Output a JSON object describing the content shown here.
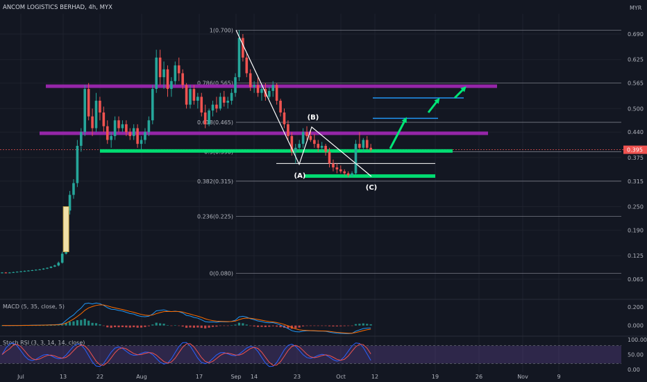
{
  "header": {
    "title": "ANCOM LOGISTICS BERHAD, 4h, MYX",
    "currency": "MYR"
  },
  "chart_data": [
    {
      "type": "candlestick",
      "ylim": [
        0.035,
        0.72
      ],
      "y_ticks": [
        "0.690",
        "0.625",
        "0.565",
        "0.500",
        "0.440",
        "0.375",
        "0.315",
        "0.250",
        "0.190",
        "0.125",
        "0.065"
      ],
      "y_tick_values": [
        0.69,
        0.625,
        0.565,
        0.5,
        0.44,
        0.375,
        0.315,
        0.25,
        0.19,
        0.125,
        0.065
      ],
      "x_ticks": [
        "Jul",
        "13",
        "22",
        "Aug",
        "17",
        "Sep",
        "14",
        "23",
        "Oct",
        "12",
        "19",
        "26",
        "Nov",
        "9"
      ],
      "last_price": "0.395",
      "last_price_value": 0.395,
      "fibonacci": [
        {
          "label": "1(0.700)",
          "value": 0.7
        },
        {
          "label": "0.786(0.565)",
          "value": 0.565
        },
        {
          "label": "0.618(0.465)",
          "value": 0.465
        },
        {
          "label": "0.5(0.390)",
          "value": 0.39
        },
        {
          "label": "0.382(0.315)",
          "value": 0.315
        },
        {
          "label": "0.236(0.225)",
          "value": 0.225
        },
        {
          "label": "0(0.080)",
          "value": 0.08
        }
      ],
      "wave_labels": [
        {
          "label": "(A)",
          "value": 0.358
        },
        {
          "label": "(B)",
          "value": 0.453
        },
        {
          "label": "(C)",
          "value": 0.327
        }
      ],
      "support_resistance": [
        {
          "color": "#9c27b0",
          "value": 0.557
        },
        {
          "color": "#9c27b0",
          "value": 0.437
        },
        {
          "color": "#00e676",
          "value": 0.392
        },
        {
          "color": "#00e676",
          "value": 0.328
        }
      ],
      "targets": [
        0.475,
        0.527
      ],
      "candles": [
        [
          0.082,
          0.083,
          0.08,
          0.082
        ],
        [
          0.082,
          0.083,
          0.08,
          0.081
        ],
        [
          0.081,
          0.083,
          0.08,
          0.082
        ],
        [
          0.082,
          0.084,
          0.081,
          0.083
        ],
        [
          0.083,
          0.085,
          0.082,
          0.084
        ],
        [
          0.084,
          0.086,
          0.083,
          0.085
        ],
        [
          0.085,
          0.087,
          0.084,
          0.086
        ],
        [
          0.086,
          0.088,
          0.085,
          0.087
        ],
        [
          0.087,
          0.089,
          0.086,
          0.088
        ],
        [
          0.088,
          0.09,
          0.087,
          0.089
        ],
        [
          0.089,
          0.091,
          0.088,
          0.09
        ],
        [
          0.09,
          0.093,
          0.089,
          0.092
        ],
        [
          0.092,
          0.095,
          0.091,
          0.094
        ],
        [
          0.094,
          0.098,
          0.093,
          0.097
        ],
        [
          0.097,
          0.102,
          0.096,
          0.1
        ],
        [
          0.1,
          0.11,
          0.098,
          0.107
        ],
        [
          0.107,
          0.135,
          0.105,
          0.13
        ],
        [
          0.13,
          0.25,
          0.128,
          0.24
        ],
        [
          0.24,
          0.29,
          0.23,
          0.28
        ],
        [
          0.28,
          0.32,
          0.27,
          0.31
        ],
        [
          0.31,
          0.42,
          0.3,
          0.405
        ],
        [
          0.405,
          0.45,
          0.39,
          0.44
        ],
        [
          0.44,
          0.56,
          0.43,
          0.55
        ],
        [
          0.55,
          0.565,
          0.47,
          0.48
        ],
        [
          0.48,
          0.5,
          0.43,
          0.45
        ],
        [
          0.45,
          0.54,
          0.44,
          0.52
        ],
        [
          0.52,
          0.53,
          0.47,
          0.49
        ],
        [
          0.49,
          0.505,
          0.44,
          0.455
        ],
        [
          0.455,
          0.47,
          0.41,
          0.42
        ],
        [
          0.42,
          0.44,
          0.4,
          0.43
        ],
        [
          0.43,
          0.48,
          0.42,
          0.47
        ],
        [
          0.47,
          0.48,
          0.44,
          0.45
        ],
        [
          0.45,
          0.47,
          0.44,
          0.46
        ],
        [
          0.46,
          0.47,
          0.43,
          0.44
        ],
        [
          0.44,
          0.45,
          0.42,
          0.43
        ],
        [
          0.43,
          0.46,
          0.42,
          0.45
        ],
        [
          0.45,
          0.46,
          0.4,
          0.41
        ],
        [
          0.41,
          0.43,
          0.395,
          0.42
        ],
        [
          0.42,
          0.45,
          0.41,
          0.44
        ],
        [
          0.44,
          0.48,
          0.43,
          0.47
        ],
        [
          0.47,
          0.56,
          0.46,
          0.55
        ],
        [
          0.55,
          0.65,
          0.54,
          0.63
        ],
        [
          0.63,
          0.65,
          0.56,
          0.58
        ],
        [
          0.58,
          0.62,
          0.55,
          0.6
        ],
        [
          0.6,
          0.61,
          0.53,
          0.55
        ],
        [
          0.55,
          0.58,
          0.53,
          0.57
        ],
        [
          0.57,
          0.62,
          0.56,
          0.61
        ],
        [
          0.61,
          0.63,
          0.57,
          0.59
        ],
        [
          0.59,
          0.6,
          0.55,
          0.56
        ],
        [
          0.56,
          0.565,
          0.5,
          0.51
        ],
        [
          0.51,
          0.56,
          0.5,
          0.55
        ],
        [
          0.55,
          0.56,
          0.51,
          0.52
        ],
        [
          0.52,
          0.54,
          0.5,
          0.53
        ],
        [
          0.53,
          0.54,
          0.48,
          0.49
        ],
        [
          0.49,
          0.51,
          0.45,
          0.46
        ],
        [
          0.46,
          0.5,
          0.455,
          0.495
        ],
        [
          0.495,
          0.52,
          0.48,
          0.51
        ],
        [
          0.51,
          0.53,
          0.49,
          0.5
        ],
        [
          0.5,
          0.54,
          0.495,
          0.53
        ],
        [
          0.53,
          0.545,
          0.505,
          0.515
        ],
        [
          0.515,
          0.53,
          0.5,
          0.52
        ],
        [
          0.52,
          0.55,
          0.51,
          0.54
        ],
        [
          0.54,
          0.59,
          0.53,
          0.58
        ],
        [
          0.58,
          0.7,
          0.57,
          0.68
        ],
        [
          0.68,
          0.69,
          0.62,
          0.63
        ],
        [
          0.63,
          0.64,
          0.58,
          0.59
        ],
        [
          0.59,
          0.6,
          0.545,
          0.555
        ],
        [
          0.555,
          0.57,
          0.54,
          0.56
        ],
        [
          0.56,
          0.58,
          0.53,
          0.54
        ],
        [
          0.54,
          0.56,
          0.52,
          0.55
        ],
        [
          0.55,
          0.565,
          0.52,
          0.53
        ],
        [
          0.53,
          0.555,
          0.525,
          0.545
        ],
        [
          0.545,
          0.57,
          0.53,
          0.56
        ],
        [
          0.56,
          0.565,
          0.51,
          0.52
        ],
        [
          0.52,
          0.525,
          0.48,
          0.49
        ],
        [
          0.49,
          0.5,
          0.45,
          0.46
        ],
        [
          0.46,
          0.47,
          0.42,
          0.43
        ],
        [
          0.43,
          0.44,
          0.38,
          0.39
        ],
        [
          0.39,
          0.41,
          0.36,
          0.4
        ],
        [
          0.4,
          0.42,
          0.39,
          0.41
        ],
        [
          0.41,
          0.45,
          0.4,
          0.44
        ],
        [
          0.44,
          0.455,
          0.42,
          0.43
        ],
        [
          0.43,
          0.445,
          0.415,
          0.42
        ],
        [
          0.42,
          0.435,
          0.4,
          0.41
        ],
        [
          0.41,
          0.42,
          0.39,
          0.4
        ],
        [
          0.4,
          0.415,
          0.39,
          0.405
        ],
        [
          0.405,
          0.41,
          0.38,
          0.39
        ],
        [
          0.39,
          0.4,
          0.35,
          0.36
        ],
        [
          0.36,
          0.37,
          0.34,
          0.35
        ],
        [
          0.35,
          0.36,
          0.335,
          0.345
        ],
        [
          0.345,
          0.355,
          0.335,
          0.34
        ],
        [
          0.34,
          0.345,
          0.33,
          0.335
        ],
        [
          0.335,
          0.34,
          0.325,
          0.33
        ],
        [
          0.33,
          0.34,
          0.325,
          0.335
        ],
        [
          0.335,
          0.42,
          0.33,
          0.41
        ],
        [
          0.41,
          0.44,
          0.395,
          0.4
        ],
        [
          0.4,
          0.425,
          0.39,
          0.42
        ],
        [
          0.42,
          0.43,
          0.395,
          0.4
        ],
        [
          0.4,
          0.41,
          0.39,
          0.395
        ]
      ]
    },
    {
      "type": "line",
      "legend": "MACD (5, 35, close, 5)",
      "y_ticks": [
        "0.200",
        "0.000"
      ],
      "y_tick_values": [
        0.2,
        0.0
      ],
      "ylim": [
        -0.1,
        0.26
      ]
    },
    {
      "type": "line",
      "legend": "Stoch RSI (3, 3, 14, 14, close)",
      "y_ticks": [
        "100.00",
        "50.00",
        "0.00"
      ],
      "y_tick_values": [
        100,
        50,
        0
      ],
      "ylim": [
        -5,
        105
      ]
    }
  ],
  "colors": {
    "up": "#26a69a",
    "down": "#ef5350",
    "background": "#131722",
    "grid": "#1e222d",
    "fib": "#787b86",
    "purple_line": "#9c27b0",
    "green_line": "#00e676",
    "target": "#2196f3",
    "arrow": "#00e676",
    "macd": "#2196f3",
    "signal": "#ff6d00",
    "stoch_k": "#2962ff",
    "stoch_d": "#ef5350",
    "stoch_band": "#7e57c2",
    "price_badge": "#ef5350",
    "highlight_box": "#f0e0a8"
  }
}
